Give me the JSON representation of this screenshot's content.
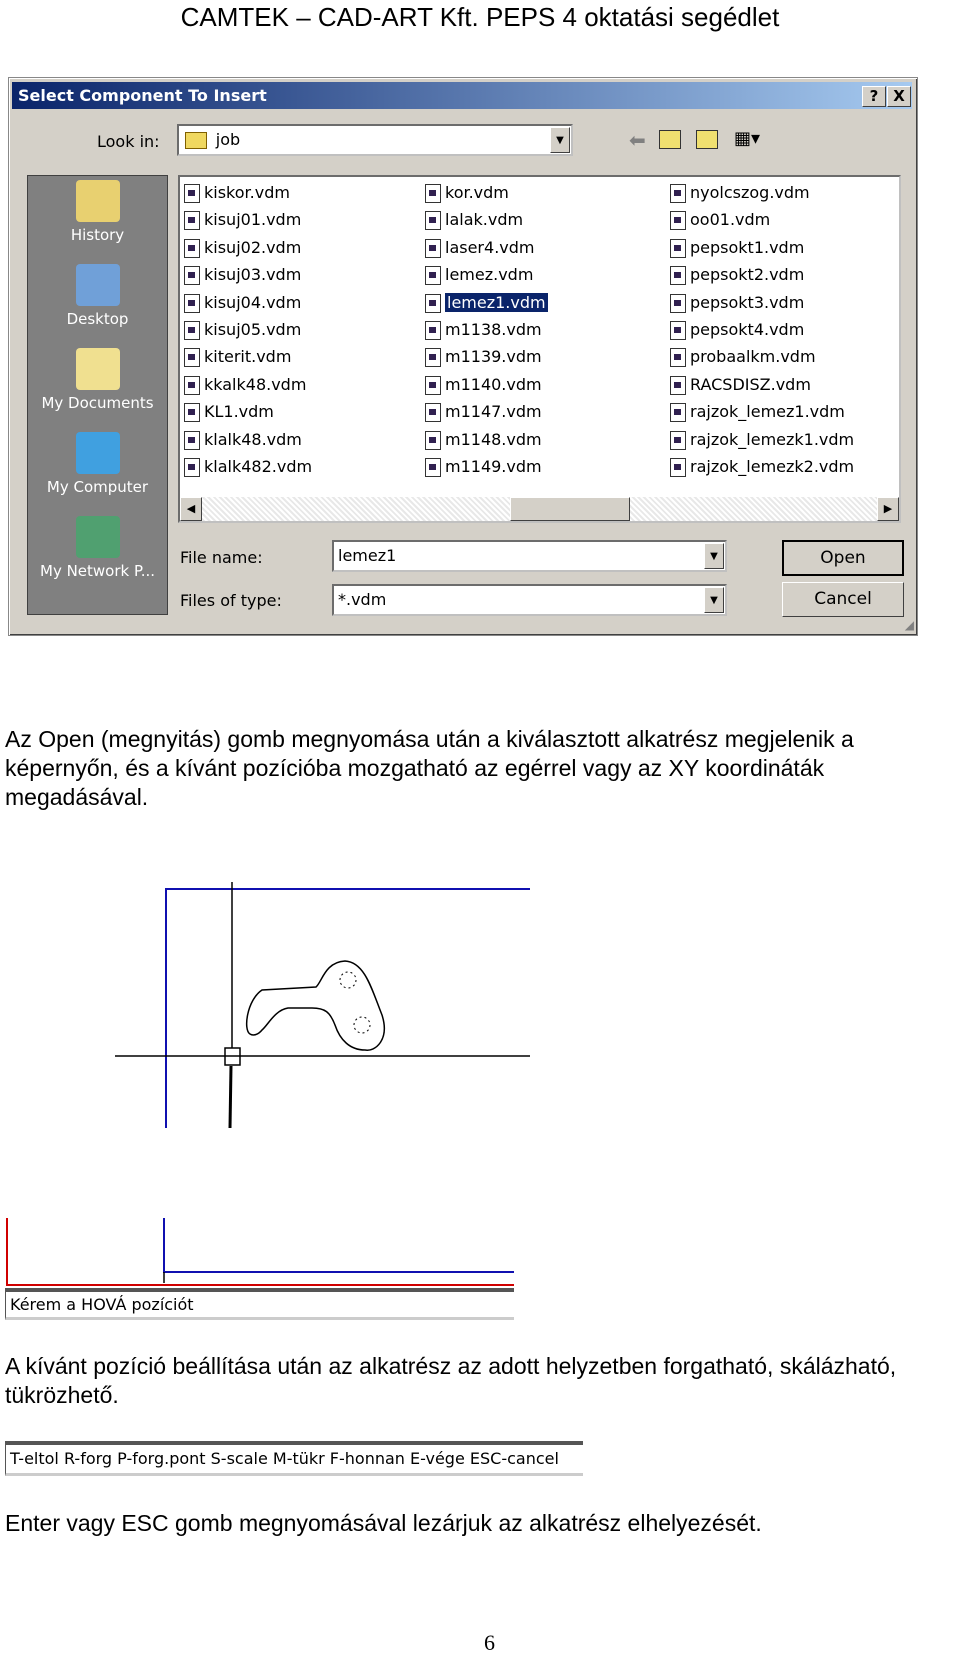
{
  "header": "CAMTEK – CAD-ART Kft. PEPS 4 oktatási segédlet",
  "dialog": {
    "title": "Select Component To Insert",
    "help_label": "?",
    "close_label": "X",
    "look_in_label": "Look in:",
    "look_in_value": "job",
    "sidebar": [
      {
        "label": "History",
        "icon": "history-icon"
      },
      {
        "label": "Desktop",
        "icon": "desktop-icon"
      },
      {
        "label": "My Documents",
        "icon": "documents-icon"
      },
      {
        "label": "My Computer",
        "icon": "computer-icon"
      },
      {
        "label": "My Network P...",
        "icon": "network-icon"
      }
    ],
    "files": [
      [
        "kiskor.vdm",
        "kisuj01.vdm",
        "kisuj02.vdm",
        "kisuj03.vdm",
        "kisuj04.vdm",
        "kisuj05.vdm",
        "kiterit.vdm",
        "kkalk48.vdm",
        "KL1.vdm",
        "klalk48.vdm",
        "klalk482.vdm"
      ],
      [
        "kor.vdm",
        "lalak.vdm",
        "laser4.vdm",
        "lemez.vdm",
        "lemez1.vdm",
        "m1138.vdm",
        "m1139.vdm",
        "m1140.vdm",
        "m1147.vdm",
        "m1148.vdm",
        "m1149.vdm"
      ],
      [
        "nyolcszog.vdm",
        "oo01.vdm",
        "pepsokt1.vdm",
        "pepsokt2.vdm",
        "pepsokt3.vdm",
        "pepsokt4.vdm",
        "probaalkm.vdm",
        "RACSDISZ.vdm",
        "rajzok_lemez1.vdm",
        "rajzok_lemezk1.vdm",
        "rajzok_lemezk2.vdm"
      ]
    ],
    "selected_file": "lemez1.vdm",
    "file_name_label": "File name:",
    "file_name_value": "lemez1",
    "files_of_type_label": "Files of type:",
    "files_of_type_value": "*.vdm",
    "open_label": "Open",
    "cancel_label": "Cancel",
    "accent": "#0a246a"
  },
  "para1": "Az Open (megnyitás) gomb megnyomása után a kiválasztott alkatrész megjelenik a képernyőn, és a kívánt pozícióba  mozgatható az egérrel vagy az XY koordináták megadásával.",
  "status_prompt": "Kérem a HOVÁ pozíciót",
  "para2": "A kívánt pozíció beállítása után az alkatrész az adott helyzetben forgatható, skálázható, tükrözhető.",
  "command_bar": "T-eltol R-forg P-forg.pont S-scale M-tükr F-honnan E-vége ESC-cancel",
  "para3": "Enter vagy ESC gomb megnyomásával lezárjuk az alkatrész elhelyezését.",
  "page_number": "6"
}
